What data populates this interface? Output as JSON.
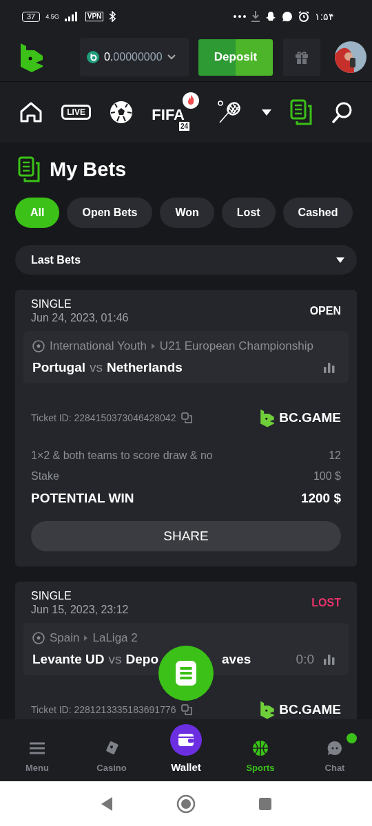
{
  "status_bar": {
    "battery": "37",
    "network": "4.5G",
    "vpn": "VPN",
    "time": "۱:۵۴"
  },
  "header": {
    "balance_whole": "0.",
    "balance_decimals": "00000000",
    "deposit": "Deposit"
  },
  "sport_nav": [
    {
      "kind": "home",
      "selected": false
    },
    {
      "kind": "live",
      "label": "LIVE",
      "selected": false
    },
    {
      "kind": "soccer",
      "selected": false
    },
    {
      "kind": "fifa",
      "label": "FIFA",
      "badge": "24",
      "selected": false
    },
    {
      "kind": "tennis",
      "selected": false
    },
    {
      "kind": "more",
      "selected": false
    },
    {
      "kind": "bets",
      "selected": true
    },
    {
      "kind": "search",
      "selected": false
    }
  ],
  "page_title": "My Bets",
  "filters": [
    {
      "label": "All",
      "selected": true
    },
    {
      "label": "Open Bets",
      "selected": false
    },
    {
      "label": "Won",
      "selected": false
    },
    {
      "label": "Lost",
      "selected": false
    },
    {
      "label": "Cashed",
      "selected": false
    }
  ],
  "period_select": {
    "value": "Last Bets"
  },
  "bets": [
    {
      "type": "SINGLE",
      "date": "Jun 24, 2023, 01:46",
      "status": "OPEN",
      "color": "#ffffff",
      "league": [
        "International Youth",
        "U21 European Championship"
      ],
      "home": "Portugal",
      "vs": "vs",
      "away": [
        "Netherlands"
      ],
      "ticket": "Ticket ID: 2284150373046428042",
      "brand": "BC.GAME",
      "selection": "1×2 & both teams to score draw & no",
      "odds": "12",
      "stake_label": "Stake",
      "stake": "100 $",
      "win_label": "POTENTIAL WIN",
      "win": "1200 $",
      "share": "SHARE"
    },
    {
      "type": "SINGLE",
      "date": "Jun 15, 2023, 23:12",
      "status": "LOST",
      "color": "#e8336b",
      "league": [
        "Spain",
        "LaLiga 2"
      ],
      "home": "Levante UD",
      "vs": "vs",
      "away": [
        "Depo",
        "aves"
      ],
      "score": "0:0",
      "ticket": "Ticket ID: 2281213335183691776",
      "brand": "BC.GAME"
    }
  ],
  "bottom_nav": [
    {
      "label": "Menu",
      "kind": "menu",
      "selected": false
    },
    {
      "label": "Casino",
      "kind": "casino",
      "selected": false
    },
    {
      "label": "Wallet",
      "kind": "wallet",
      "selected": false
    },
    {
      "label": "Sports",
      "kind": "sports",
      "selected": true
    },
    {
      "label": "Chat",
      "kind": "chat",
      "selected": false,
      "dot": true
    }
  ]
}
